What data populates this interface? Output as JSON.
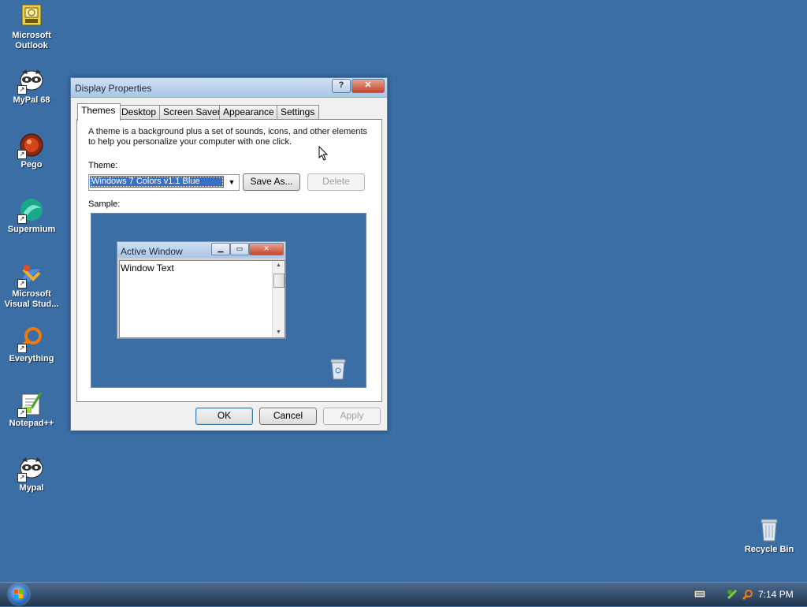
{
  "desktop": {
    "icons": [
      {
        "label": "Microsoft Outlook",
        "icon": "outlook-icon"
      },
      {
        "label": "MyPal 68",
        "icon": "mypal-icon"
      },
      {
        "label": "Pego",
        "icon": "pego-icon"
      },
      {
        "label": "Supermium",
        "icon": "supermium-icon"
      },
      {
        "label": "Microsoft Visual Stud...",
        "icon": "visual-studio-icon"
      },
      {
        "label": "Everything",
        "icon": "everything-icon"
      },
      {
        "label": "Notepad++",
        "icon": "notepadpp-icon"
      },
      {
        "label": "Mypal",
        "icon": "mypal-icon"
      }
    ],
    "recycle_bin": "Recycle Bin",
    "background_color": "#3a6ea5"
  },
  "dialog": {
    "title": "Display Properties",
    "help_symbol": "?",
    "close_symbol": "✕",
    "tabs": [
      "Themes",
      "Desktop",
      "Screen Saver",
      "Appearance",
      "Settings"
    ],
    "active_tab": "Themes",
    "description": "A theme is a background plus a set of sounds, icons, and other elements to help you personalize your computer with one click.",
    "theme_label": "Theme:",
    "theme_value": "Windows 7 Colors v1.1 Blue",
    "save_as": "Save As...",
    "delete": "Delete",
    "sample_label": "Sample:",
    "sample": {
      "window_title": "Active Window",
      "window_text": "Window Text"
    },
    "ok": "OK",
    "cancel": "Cancel",
    "apply": "Apply"
  },
  "taskbar": {
    "clock": "7:14 PM",
    "tray_icons": [
      "keyboard-icon",
      "network-icon",
      "search-icon"
    ]
  }
}
